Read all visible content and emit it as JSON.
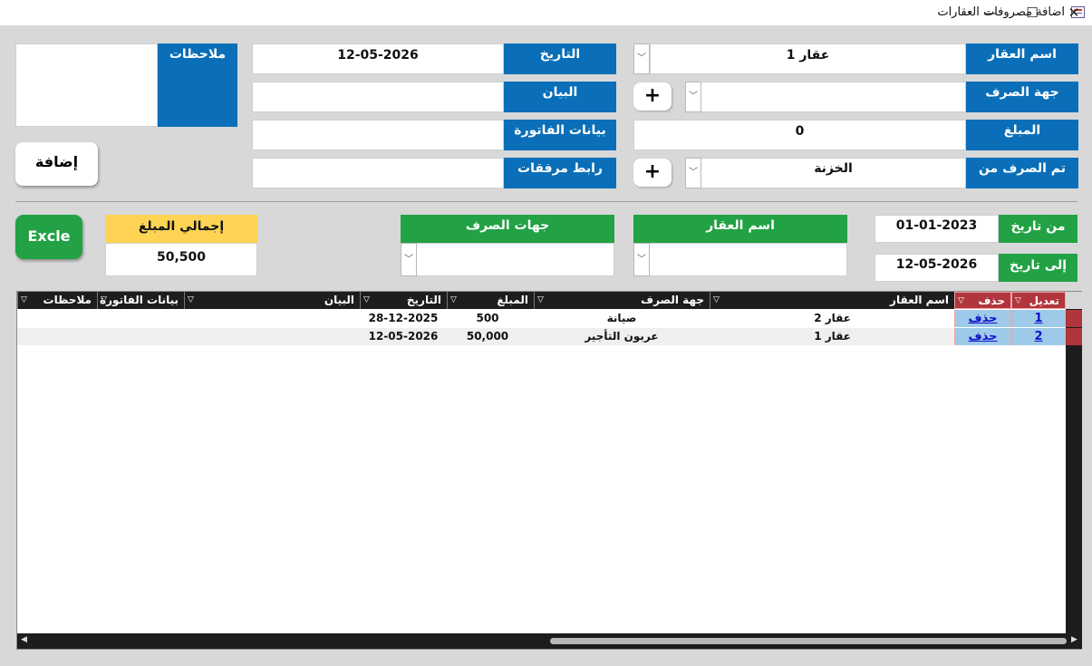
{
  "window": {
    "title": "اضافة مصروفات العقارات",
    "minimize": "—",
    "maximize": "☐",
    "close": "✕"
  },
  "form": {
    "property_name": {
      "label": "اسم العقار",
      "value": "عقار 1"
    },
    "expense_party": {
      "label": "جهة الصرف",
      "value": ""
    },
    "amount": {
      "label": "المبلغ",
      "value": "0"
    },
    "paid_from": {
      "label": "تم الصرف من",
      "value": "الخزنة"
    },
    "date": {
      "label": "التاريخ",
      "value": "12-05-2026"
    },
    "statement": {
      "label": "البيان",
      "value": ""
    },
    "invoice_data": {
      "label": "بيانات الفاتورة",
      "value": ""
    },
    "attachments_link": {
      "label": "رابط مرفقات",
      "value": ""
    },
    "notes": {
      "label": "ملاحظات",
      "value": ""
    },
    "add_button": "إضافة",
    "plus": "+"
  },
  "filters": {
    "from_date": {
      "label": "من تاريخ",
      "value": "01-01-2023"
    },
    "to_date": {
      "label": "إلى تاريخ",
      "value": "12-05-2026"
    },
    "property_name": {
      "label": "اسم العقار",
      "value": ""
    },
    "expense_parties": {
      "label": "جهات الصرف",
      "value": ""
    },
    "total": {
      "label": "إجمالي المبلغ",
      "value": "50,500"
    },
    "excel_button": "Excle"
  },
  "grid": {
    "headers": {
      "edit": "تعديل",
      "delete": "حذف",
      "property": "اسم العقار",
      "party": "جهة الصرف",
      "amount": "المبلغ",
      "date": "التاريخ",
      "statement": "البيان",
      "invoice": "بيانات الفاتورة",
      "notes": "ملاحظات"
    },
    "rows": [
      {
        "edit": "1",
        "delete": "حذف",
        "property": "عقار 2",
        "party": "صيانة",
        "amount": "500",
        "date": "28-12-2025",
        "statement": "",
        "invoice": "",
        "notes": ""
      },
      {
        "edit": "2",
        "delete": "حذف",
        "property": "عقار 1",
        "party": "عربون التأجير",
        "amount": "50,000",
        "date": "12-05-2026",
        "statement": "",
        "invoice": "",
        "notes": ""
      }
    ]
  },
  "colors": {
    "blue": "#0a6fb8",
    "green": "#22a244",
    "yellow": "#ffd455",
    "header_red": "#b0353c",
    "link_bg": "#9ecae9"
  }
}
